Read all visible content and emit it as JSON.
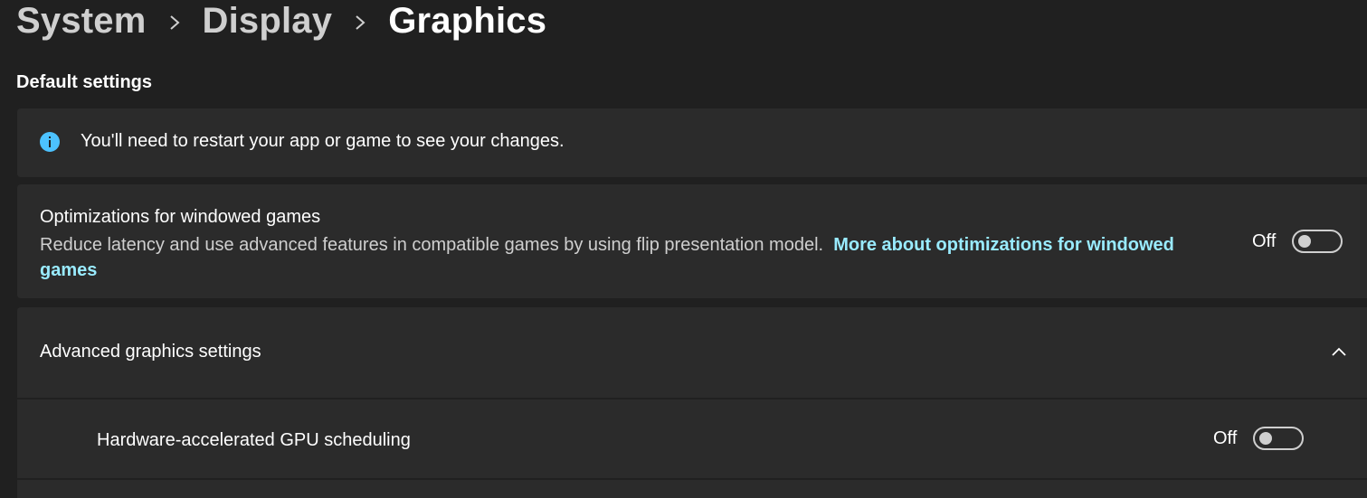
{
  "breadcrumb": {
    "items": [
      "System",
      "Display",
      "Graphics"
    ]
  },
  "section": {
    "title": "Default settings"
  },
  "info_banner": {
    "icon": "info-icon",
    "text": "You'll need to restart your app or game to see your changes."
  },
  "windowed_games": {
    "title": "Optimizations for windowed games",
    "description": "Reduce latency and use advanced features in compatible games by using flip presentation model.",
    "link_text": "More about optimizations for windowed games",
    "toggle_label": "Off",
    "toggle_on": false
  },
  "advanced": {
    "title": "Advanced graphics settings",
    "expanded": true,
    "icon": "chevron-up-icon"
  },
  "gpu_scheduling": {
    "title": "Hardware-accelerated GPU scheduling",
    "toggle_label": "Off",
    "toggle_on": false
  },
  "colors": {
    "background": "#202020",
    "card": "#2b2b2b",
    "accent": "#4cc2ff",
    "link": "#99ebff"
  }
}
